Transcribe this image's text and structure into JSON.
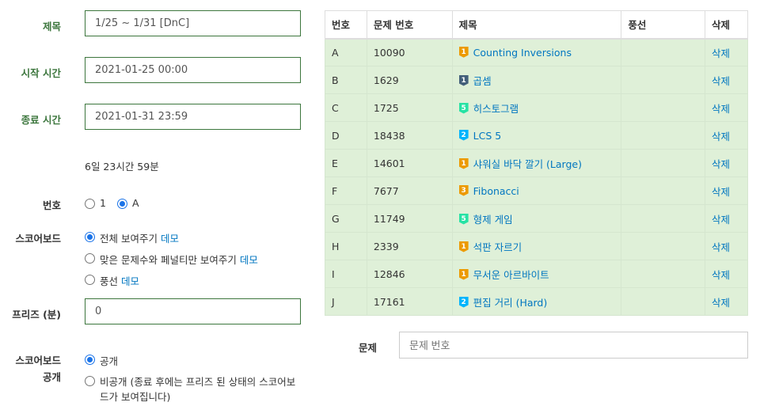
{
  "form": {
    "title_label": "제목",
    "title_value": "1/25 ~ 1/31 [DnC]",
    "start_label": "시작 시간",
    "start_value": "2021-01-25 00:00",
    "end_label": "종료 시간",
    "end_value": "2021-01-31 23:59",
    "duration": "6일 23시간 59분",
    "number_label": "번호",
    "number_options": [
      "1",
      "A"
    ],
    "number_selected": "A",
    "scoreboard_label": "스코어보드",
    "scoreboard_options": [
      {
        "text": "전체 보여주기",
        "link": "데모",
        "checked": true
      },
      {
        "text": "맞은 문제수와 페널티만 보여주기",
        "link": "데모",
        "checked": false
      },
      {
        "text": "풍선",
        "link": "데모",
        "checked": false
      }
    ],
    "freeze_label": "프리즈 (분)",
    "freeze_value": "0",
    "public_label_1": "스코어보드",
    "public_label_2": "공개",
    "public_options": [
      {
        "text": "공개",
        "checked": true
      },
      {
        "text_line1": "비공개 (종료 후에는 프리즈 된 상태의 스코어보",
        "text_line2": "드가 보여집니다)",
        "checked": false
      }
    ]
  },
  "table": {
    "headers": [
      "번호",
      "문제 번호",
      "제목",
      "풍선",
      "삭제"
    ],
    "rows": [
      {
        "num": "A",
        "id": "10090",
        "title": "Counting Inversions",
        "tier": "1",
        "tier_color": "#ec9a00",
        "balloon": "",
        "del": "삭제"
      },
      {
        "num": "B",
        "id": "1629",
        "title": "곱셈",
        "tier": "1",
        "tier_color": "#435f7a",
        "balloon": "",
        "del": "삭제"
      },
      {
        "num": "C",
        "id": "1725",
        "title": "히스토그램",
        "tier": "5",
        "tier_color": "#27e2a4",
        "balloon": "",
        "del": "삭제"
      },
      {
        "num": "D",
        "id": "18438",
        "title": "LCS 5",
        "tier": "2",
        "tier_color": "#00b4fc",
        "balloon": "",
        "del": "삭제"
      },
      {
        "num": "E",
        "id": "14601",
        "title": "샤워실 바닥 깔기 (Large)",
        "tier": "1",
        "tier_color": "#ec9a00",
        "balloon": "",
        "del": "삭제"
      },
      {
        "num": "F",
        "id": "7677",
        "title": "Fibonacci",
        "tier": "3",
        "tier_color": "#ec9a00",
        "balloon": "",
        "del": "삭제"
      },
      {
        "num": "G",
        "id": "11749",
        "title": "형제 게임",
        "tier": "5",
        "tier_color": "#27e2a4",
        "balloon": "",
        "del": "삭제"
      },
      {
        "num": "H",
        "id": "2339",
        "title": "석판 자르기",
        "tier": "1",
        "tier_color": "#ec9a00",
        "balloon": "",
        "del": "삭제"
      },
      {
        "num": "I",
        "id": "12846",
        "title": "무서운 아르바이트",
        "tier": "1",
        "tier_color": "#ec9a00",
        "balloon": "",
        "del": "삭제"
      },
      {
        "num": "J",
        "id": "17161",
        "title": "편집 거리 (Hard)",
        "tier": "2",
        "tier_color": "#00b4fc",
        "balloon": "",
        "del": "삭제"
      }
    ]
  },
  "problem_add": {
    "label": "문제",
    "placeholder": "문제 번호"
  }
}
